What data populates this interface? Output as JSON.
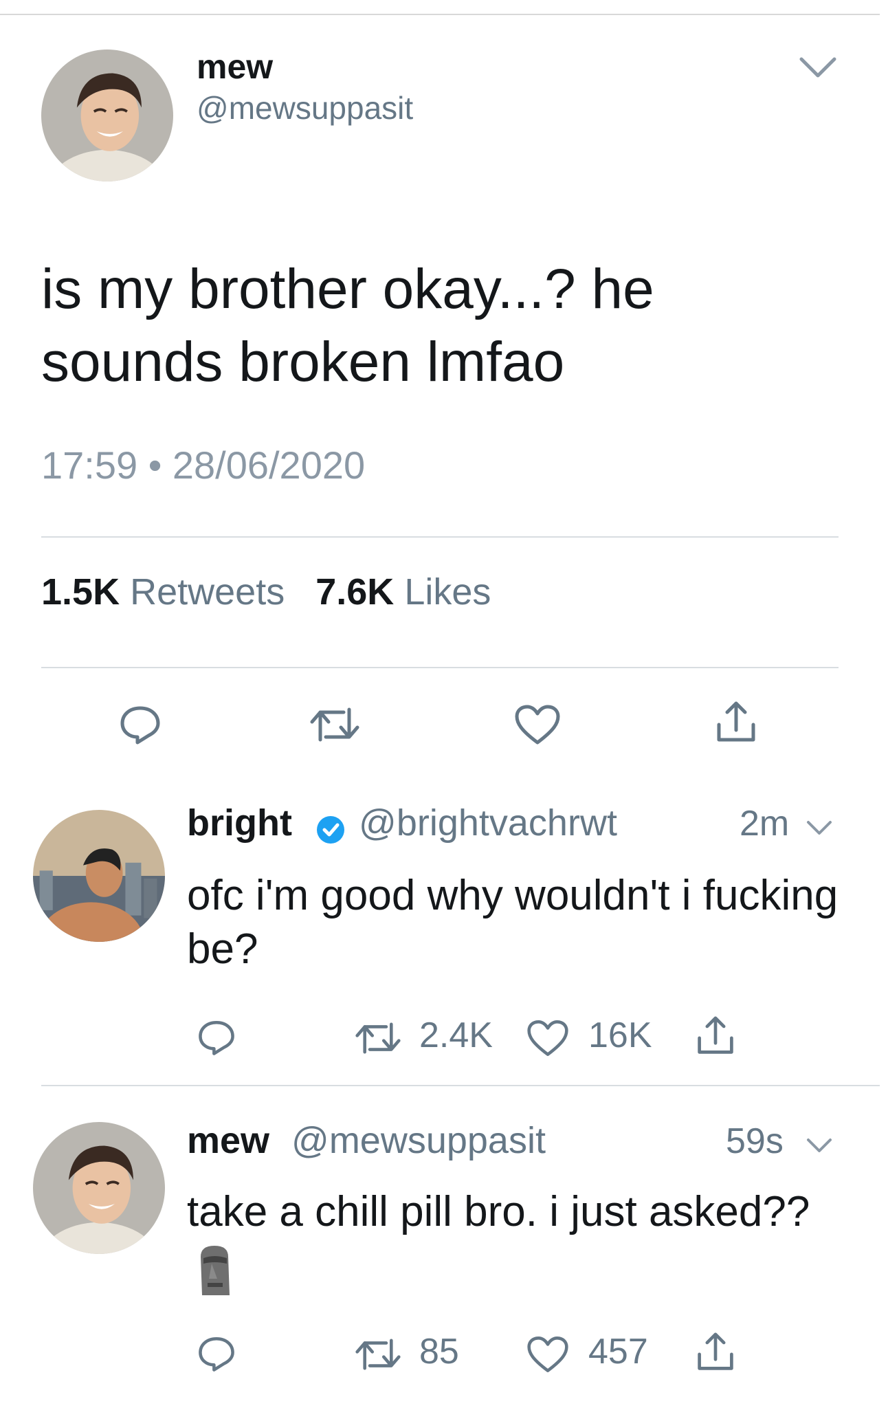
{
  "main_tweet": {
    "name": "mew",
    "handle": "@mewsuppasit",
    "text": "is my brother okay...? he sounds broken lmfao",
    "timestamp": "17:59 • 28/06/2020",
    "retweets_count": "1.5K",
    "retweets_label": "Retweets",
    "likes_count": "7.6K",
    "likes_label": "Likes"
  },
  "replies": [
    {
      "name": "bright",
      "verified": true,
      "handle": "@brightvachrwt",
      "time": "2m",
      "text": "ofc i'm good why wouldn't i fucking be?",
      "retweets": "2.4K",
      "likes": "16K"
    },
    {
      "name": "mew",
      "verified": false,
      "handle": "@mewsuppasit",
      "time": "59s",
      "text": "take a chill pill bro. i just asked??",
      "emoji": "🗿",
      "retweets": "85",
      "likes": "457"
    }
  ],
  "colors": {
    "text": "#14171a",
    "secondary": "#657786",
    "verified_blue": "#1da1f2",
    "icon_gray": "#657786"
  },
  "icons": [
    "chevron-down-icon",
    "reply-icon",
    "retweet-icon",
    "like-icon",
    "share-icon",
    "verified-badge-icon",
    "moai-emoji-icon"
  ]
}
